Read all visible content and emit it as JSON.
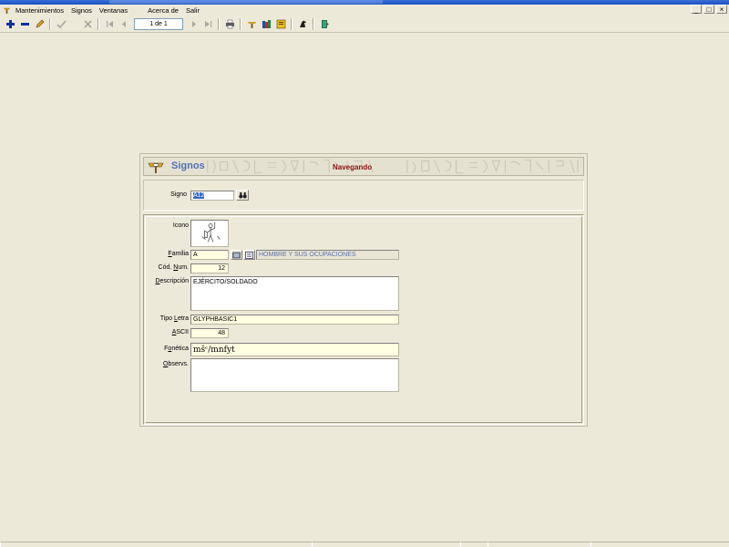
{
  "window": {
    "min": "_",
    "max": "□",
    "close": "×"
  },
  "menu": {
    "items": [
      "Mantenimientos",
      "Signos",
      "Ventanas",
      "Acerca de",
      "Salir"
    ]
  },
  "toolbar": {
    "record_position": "1 de 1"
  },
  "form": {
    "title": "Signos",
    "status": "Navegando",
    "signo": {
      "label": "Signo",
      "value": "A12"
    },
    "icono": {
      "label": "Icono"
    },
    "familia": {
      "label": "Familia",
      "value": "A",
      "description": "HOMBRE Y SUS OCUPACIONES"
    },
    "cod_num": {
      "label": "Cód. Num.",
      "value": "12"
    },
    "descripcion": {
      "label": "Descripción",
      "value": "EJÉRCITO/SOLDADO"
    },
    "tipo_letra": {
      "label": "Tipo Letra",
      "value": "GLYPHBASIC1"
    },
    "ascii": {
      "label": "ASCII",
      "value": "48"
    },
    "fonetica": {
      "label": "Fonética",
      "value": "mšᶜ/mnfyt"
    },
    "observs": {
      "label": "Observs.",
      "value": ""
    }
  },
  "colors": {
    "background": "#ece9d8",
    "title_blue": "#5070b8",
    "status_red": "#8b1010",
    "field_yellow": "#ffffe1",
    "selection": "#316ac5"
  }
}
